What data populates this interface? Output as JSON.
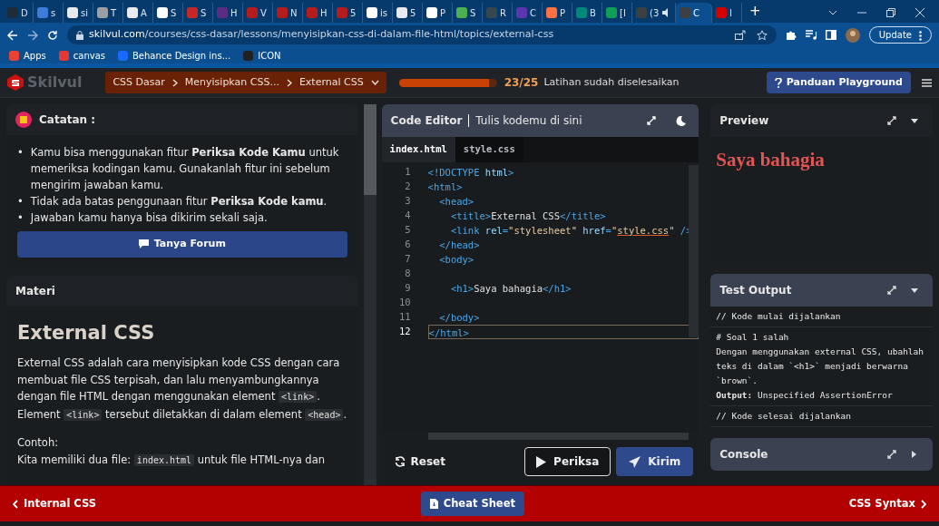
{
  "browser": {
    "tabs": [
      {
        "title": "D",
        "color": "#1d2b3a",
        "selected": false
      },
      {
        "title": "s",
        "color": "#3b7dd8",
        "selected": false
      },
      {
        "title": "si",
        "color": "#e8eaed",
        "selected": false
      },
      {
        "title": "T",
        "color": "#9aa0a6",
        "selected": false
      },
      {
        "title": "A",
        "color": "#e8eaed",
        "selected": false
      },
      {
        "title": "S",
        "color": "#ffffff",
        "selected": false
      },
      {
        "title": "S",
        "color": "#c62828",
        "selected": false
      },
      {
        "title": "H",
        "color": "#5b2c83",
        "selected": false
      },
      {
        "title": "V",
        "color": "#b71c1c",
        "selected": false
      },
      {
        "title": "N",
        "color": "#b71c1c",
        "selected": false
      },
      {
        "title": "H",
        "color": "#b71c1c",
        "selected": false
      },
      {
        "title": "5",
        "color": "#b71c1c",
        "selected": false
      },
      {
        "title": "is",
        "color": "#ffffff",
        "selected": false
      },
      {
        "title": "5",
        "color": "#e8eaed",
        "selected": false
      },
      {
        "title": "P",
        "color": "#ffffff",
        "selected": false
      },
      {
        "title": "S",
        "color": "#4caf50",
        "selected": false
      },
      {
        "title": "R",
        "color": "#37474f",
        "selected": false
      },
      {
        "title": "C",
        "color": "#5e35b1",
        "selected": false
      },
      {
        "title": "P",
        "color": "#ff7043",
        "selected": false
      },
      {
        "title": "B",
        "color": "#00897b",
        "selected": false
      },
      {
        "title": "[I",
        "color": "#0f9d58",
        "selected": false
      },
      {
        "title": "(3",
        "color": "#3c4043",
        "selected": false,
        "audio": true
      },
      {
        "title": "C",
        "color": "#3c4043",
        "selected": true
      },
      {
        "title": "I",
        "color": "#d50000",
        "selected": false
      }
    ],
    "new_tab": "+",
    "url_host": "skilvul.com",
    "url_path": "/courses/css-dasar/lessons/menyisipkan-css-di-dalam-file-html/topics/external-css",
    "update_button": "Update",
    "bookmarks": [
      {
        "label": "Apps",
        "color": "#ea4335"
      },
      {
        "label": "canvas",
        "color": "#e53935"
      },
      {
        "label": "Behance Design ins...",
        "color": "#1769ff"
      },
      {
        "label": "ICON",
        "color": "#202124"
      }
    ]
  },
  "header": {
    "logo": "Skilvul",
    "breadcrumb": [
      "CSS Dasar",
      "Menyisipkan CSS...",
      "External CSS"
    ],
    "progress": {
      "level": 0.92,
      "count": "23/25",
      "label": "Latihan sudah diselesaikan"
    },
    "help_button": "Panduan Playground"
  },
  "notes": {
    "title": "Catatan :",
    "bullet": "•",
    "items": [
      "Kamu bisa menggunakan fitur **Periksa Kode Kamu** untuk memeriksa kodingan kamu. Gunakanlah fitur ini sebelum mengirim jawaban kamu.",
      "Tidak ada batas penggunaan fitur **Periksa Kode kamu**.",
      "Jawaban kamu hanya bisa dikirim sekali saja."
    ],
    "forum_button": "Tanya Forum"
  },
  "material": {
    "title": "Materi",
    "heading": "External CSS",
    "paragraphs": [
      [
        {
          "kind": "text",
          "text": "External CSS adalah cara menyisipkan kode CSS dengan cara membuat file CSS terpisah, dan lalu menyambungkannya dengan file HTML dengan menggunakan element "
        },
        {
          "kind": "code",
          "text": "<link>"
        },
        {
          "kind": "text",
          "text": ". Element "
        },
        {
          "kind": "code",
          "text": "<link>"
        },
        {
          "kind": "text",
          "text": " tersebut diletakkan di dalam element "
        },
        {
          "kind": "code",
          "text": "<head>"
        },
        {
          "kind": "text",
          "text": "."
        }
      ],
      [
        {
          "kind": "text",
          "text": "Contoh:"
        }
      ],
      [
        {
          "kind": "text",
          "text": "Kita memiliki dua file: "
        },
        {
          "kind": "code",
          "text": "index.html"
        },
        {
          "kind": "text",
          "text": " untuk file HTML-nya dan"
        }
      ]
    ]
  },
  "editor": {
    "title": "Code Editor",
    "subtitle": "Tulis kodemu di sini",
    "files": [
      {
        "name": "index.html",
        "selected": true
      },
      {
        "name": "style.css",
        "selected": false
      }
    ],
    "lines": [
      {
        "number": "1",
        "selected": false,
        "tokens": [
          {
            "kind": "tag",
            "text": "<!DOCTYPE "
          },
          {
            "kind": "attr",
            "text": "html"
          },
          {
            "kind": "tag",
            "text": ">"
          }
        ]
      },
      {
        "number": "2",
        "selected": false,
        "tokens": [
          {
            "kind": "tag",
            "text": "<html>"
          }
        ]
      },
      {
        "number": "3",
        "selected": false,
        "tokens": [
          {
            "kind": "tag",
            "text": "  <head>"
          }
        ]
      },
      {
        "number": "4",
        "selected": false,
        "tokens": [
          {
            "kind": "tag",
            "text": "    <title>"
          },
          {
            "kind": "plain",
            "text": "External CSS"
          },
          {
            "kind": "tag",
            "text": "</title>"
          }
        ]
      },
      {
        "number": "5",
        "selected": false,
        "tokens": [
          {
            "kind": "tag",
            "text": "    <link "
          },
          {
            "kind": "attr",
            "text": "rel"
          },
          {
            "kind": "tag",
            "text": "="
          },
          {
            "kind": "string",
            "text": "\"stylesheet\" "
          },
          {
            "kind": "attr",
            "text": "href"
          },
          {
            "kind": "tag",
            "text": "="
          },
          {
            "kind": "string",
            "text": "\""
          },
          {
            "kind": "link",
            "text": "style.css"
          },
          {
            "kind": "string",
            "text": "\""
          },
          {
            "kind": "tag",
            "text": " />"
          }
        ]
      },
      {
        "number": "6",
        "selected": false,
        "tokens": [
          {
            "kind": "tag",
            "text": "  </head>"
          }
        ]
      },
      {
        "number": "7",
        "selected": false,
        "tokens": [
          {
            "kind": "tag",
            "text": "  <body>"
          }
        ]
      },
      {
        "number": "8",
        "selected": false
      },
      {
        "number": "9",
        "selected": false,
        "tokens": [
          {
            "kind": "tag",
            "text": "    <h1>"
          },
          {
            "kind": "plain",
            "text": "Saya bahagia"
          },
          {
            "kind": "tag",
            "text": "</h1>"
          }
        ]
      },
      {
        "number": "10",
        "selected": false
      },
      {
        "number": "11",
        "selected": false,
        "tokens": [
          {
            "kind": "tag",
            "text": "  </body>"
          }
        ]
      },
      {
        "number": "12",
        "selected": true,
        "tokens": [
          {
            "kind": "tag",
            "text": "</html>"
          }
        ]
      }
    ],
    "buttons": [
      {
        "kind": "reset",
        "label": "Reset"
      },
      {
        "kind": "check",
        "label": "Periksa"
      },
      {
        "kind": "submit",
        "label": "Kirim"
      }
    ]
  },
  "preview": {
    "title": "Preview",
    "heading": "Saya bahagia"
  },
  "test_output": {
    "title": "Test Output",
    "blocks": [
      [
        "// Kode mulai dijalankan"
      ],
      [
        "# Soal 1 salah",
        "Dengan menggunakan external CSS, ubahlah teks di dalam `<h1>` menjadi berwarna `brown`.",
        "**Output:** Unspecified AssertionError"
      ],
      [
        "// Kode selesai dijalankan"
      ]
    ]
  },
  "console": {
    "title": "Console",
    "expanded": false
  },
  "footer": {
    "previous": "Internal CSS",
    "cheat_sheet": "Cheat Sheet",
    "next": "CSS Syntax"
  }
}
